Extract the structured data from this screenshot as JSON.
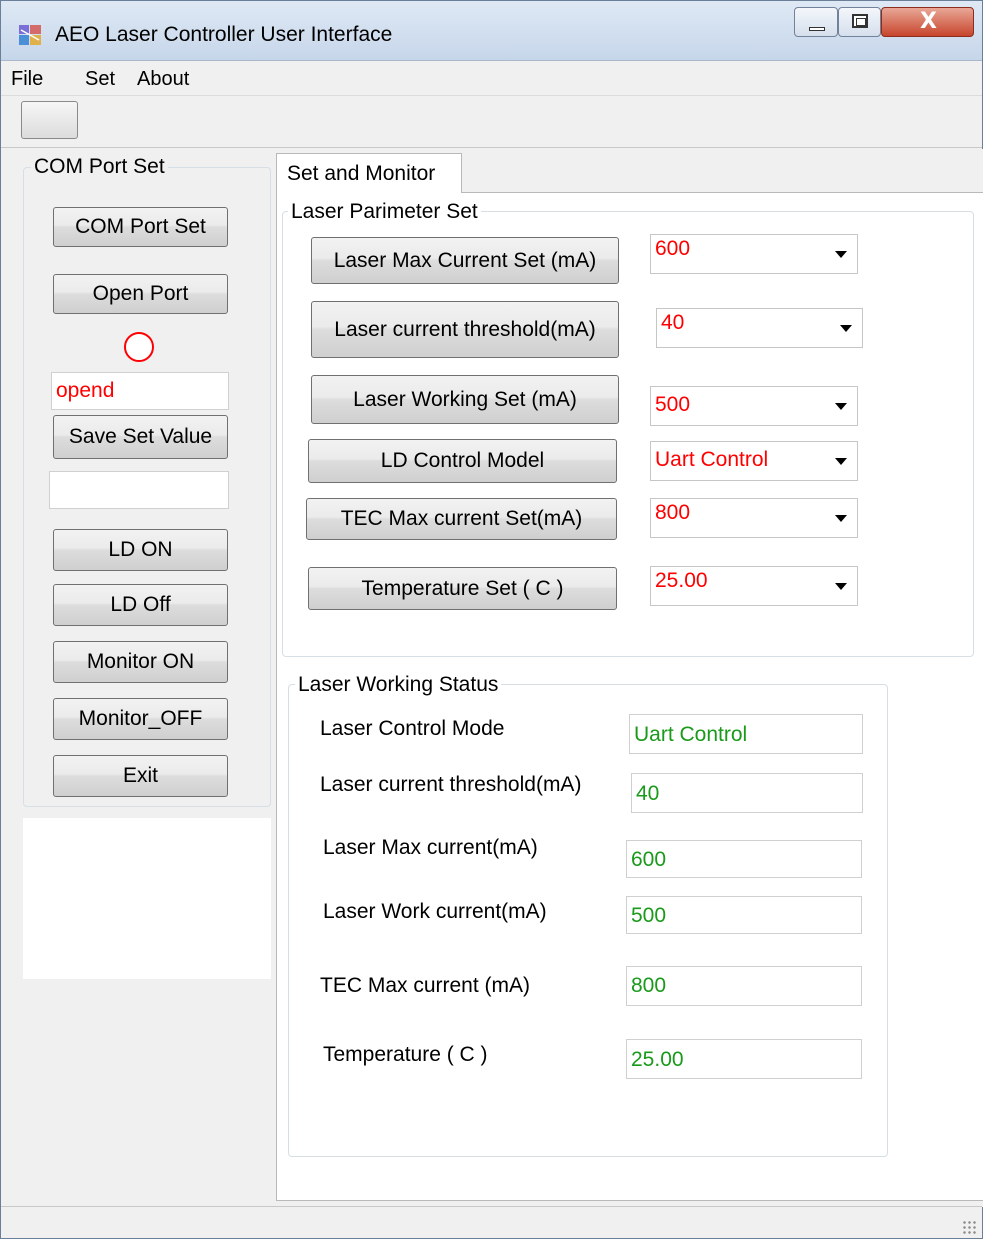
{
  "window": {
    "title": "AEO Laser Controller User Interface",
    "close_glyph": "X"
  },
  "menu": [
    "File",
    "Set",
    "About"
  ],
  "left_panel": {
    "group_title": "COM Port Set",
    "buttons": {
      "com_port_set": "COM Port Set",
      "open_port": "Open Port",
      "save_set_value": "Save Set Value",
      "ld_on": "LD ON",
      "ld_off": "LD Off",
      "monitor_on": "Monitor ON",
      "monitor_off": "Monitor_OFF",
      "exit": "Exit"
    },
    "port_status": "opend",
    "save_status": "",
    "led_color": "#ff0000"
  },
  "tab": {
    "label": "Set and Monitor"
  },
  "parameter_set": {
    "title": "Laser Parimeter Set",
    "rows": [
      {
        "button": "Laser Max Current Set (mA)",
        "value": "600"
      },
      {
        "button": "Laser current threshold(mA)",
        "value": "40"
      },
      {
        "button": "Laser Working Set (mA)",
        "value": "500"
      },
      {
        "button": "LD Control Model",
        "value": "Uart Control"
      },
      {
        "button": "TEC Max current Set(mA)",
        "value": "800"
      },
      {
        "button": "Temperature Set ( C )",
        "value": "25.00"
      }
    ]
  },
  "working_status": {
    "title": "Laser Working Status",
    "rows": [
      {
        "label": "Laser Control Mode",
        "value": "Uart Control"
      },
      {
        "label": "Laser current threshold(mA)",
        "value": "40"
      },
      {
        "label": "Laser Max current(mA)",
        "value": "600"
      },
      {
        "label": "Laser  Work current(mA)",
        "value": "500"
      },
      {
        "label": "TEC Max current (mA)",
        "value": "800"
      },
      {
        "label": "Temperature  ( C )",
        "value": "25.00"
      }
    ]
  },
  "colors": {
    "set_value": "#ff0000",
    "status_value": "#1a9a1a"
  }
}
